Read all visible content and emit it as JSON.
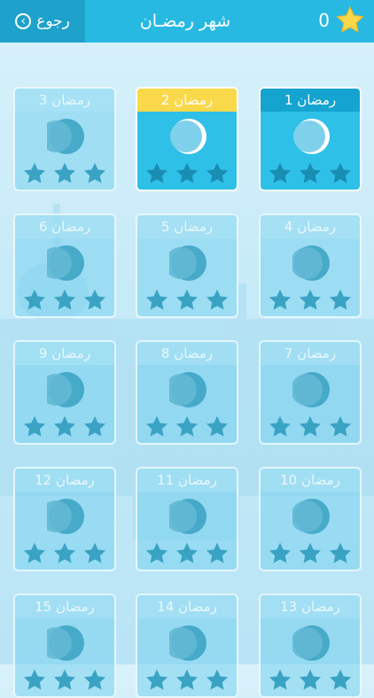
{
  "header": {
    "back_label": "رجوع",
    "title": "شهر رمضـان",
    "score": "0"
  },
  "colors": {
    "topbar": "#28b9e3",
    "back_bg": "#1ea2cc",
    "gold": "#f9d84a",
    "star_empty": "#1a8db3"
  },
  "days": [
    {
      "label": "1 رمضان",
      "state": "completed"
    },
    {
      "label": "2 رمضان",
      "state": "current"
    },
    {
      "label": "3 رمضان",
      "state": "locked"
    },
    {
      "label": "4 رمضان",
      "state": "locked"
    },
    {
      "label": "5 رمضان",
      "state": "locked"
    },
    {
      "label": "6 رمضان",
      "state": "locked"
    },
    {
      "label": "7 رمضان",
      "state": "locked"
    },
    {
      "label": "8 رمضان",
      "state": "locked"
    },
    {
      "label": "9 رمضان",
      "state": "locked"
    },
    {
      "label": "10 رمضان",
      "state": "locked"
    },
    {
      "label": "11 رمضان",
      "state": "locked"
    },
    {
      "label": "12 رمضان",
      "state": "locked"
    },
    {
      "label": "13 رمضان",
      "state": "locked"
    },
    {
      "label": "14 رمضان",
      "state": "locked"
    },
    {
      "label": "15 رمضان",
      "state": "locked"
    }
  ]
}
